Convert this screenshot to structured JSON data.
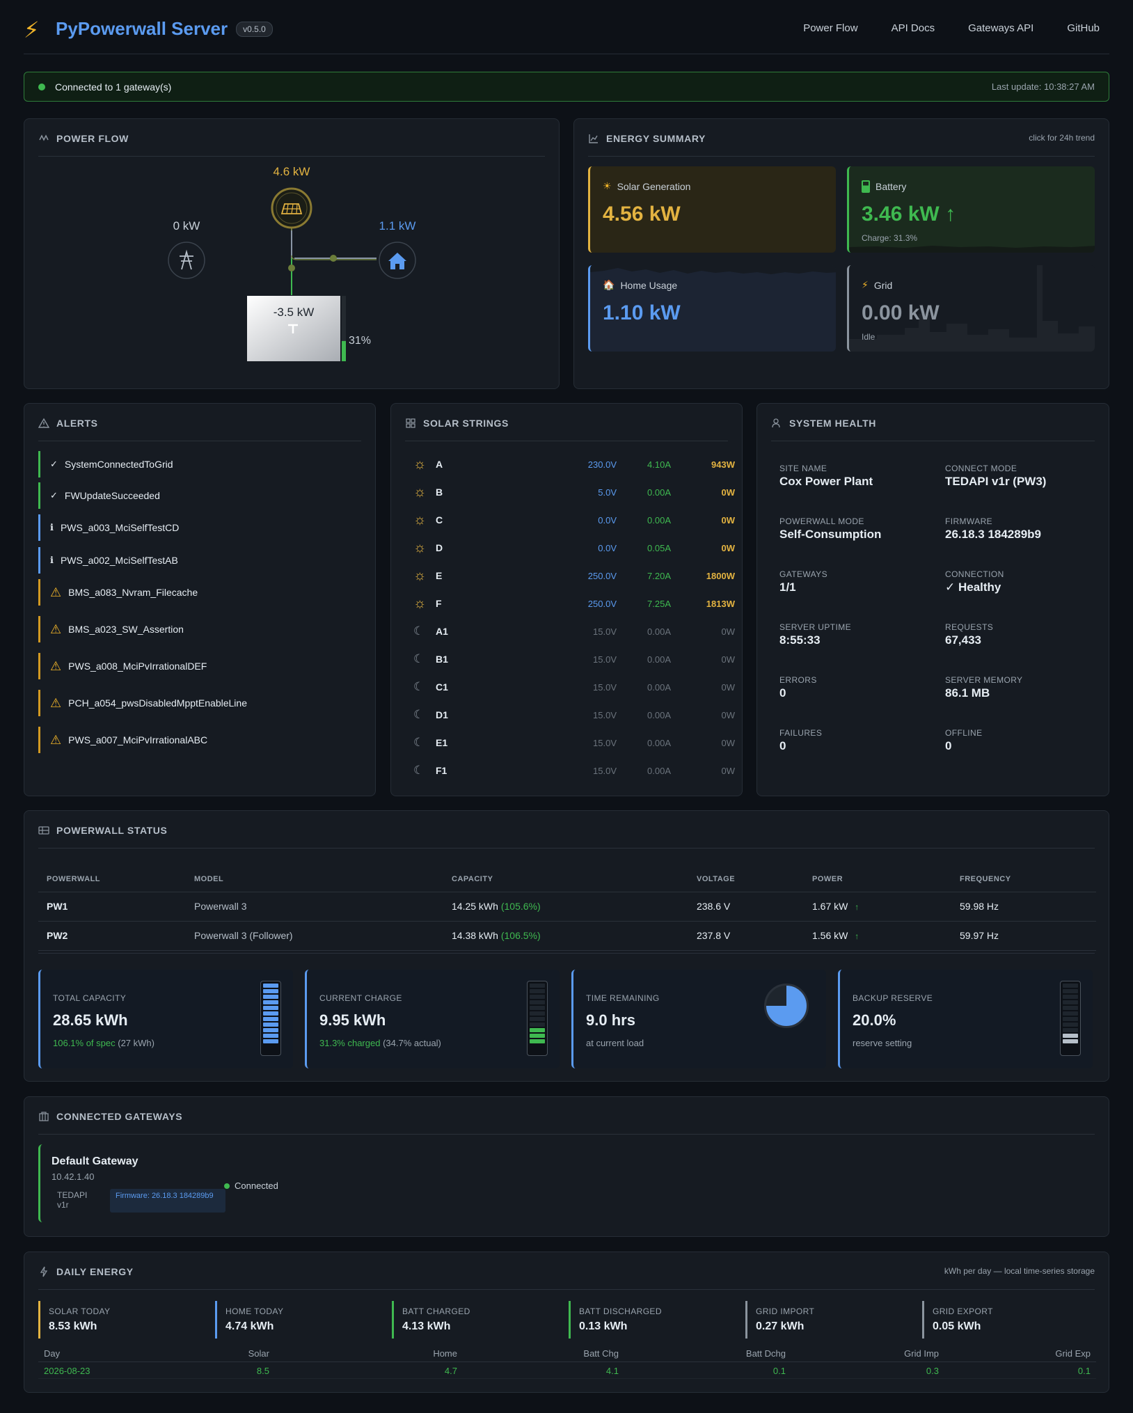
{
  "header": {
    "title": "PyPowerwall Server",
    "version": "v0.5.0",
    "nav": [
      "Power Flow",
      "API Docs",
      "Gateways API",
      "GitHub"
    ]
  },
  "banner": {
    "status": "Connected to 1 gateway(s)",
    "last_update": "Last update: 10:38:27 AM"
  },
  "power_flow": {
    "title": "POWER FLOW",
    "solar": "4.6 kW",
    "grid": "0 kW",
    "home": "1.1 kW",
    "battery": "-3.5 kW",
    "battery_pct": "31%",
    "battery_level": 0.31
  },
  "energy_summary": {
    "title": "ENERGY SUMMARY",
    "hint": "click for 24h trend",
    "solar": {
      "label": "Solar Generation",
      "value": "4.56 kW"
    },
    "battery": {
      "label": "Battery",
      "value": "3.46 kW",
      "arrow": "↑",
      "sub": "Charge: 31.3%"
    },
    "home": {
      "label": "Home Usage",
      "value": "1.10 kW"
    },
    "grid": {
      "label": "Grid",
      "value": "0.00 kW",
      "sub": "Idle"
    }
  },
  "alerts": {
    "title": "ALERTS",
    "items": [
      {
        "icon": "✓",
        "text": "SystemConnectedToGrid",
        "level": "ok"
      },
      {
        "icon": "✓",
        "text": "FWUpdateSucceeded",
        "level": "ok"
      },
      {
        "icon": "ℹ",
        "text": "PWS_a003_MciSelfTestCD",
        "level": "info"
      },
      {
        "icon": "ℹ",
        "text": "PWS_a002_MciSelfTestAB",
        "level": "info"
      },
      {
        "icon": "⚠",
        "text": "BMS_a083_Nvram_Filecache",
        "level": "warn"
      },
      {
        "icon": "⚠",
        "text": "BMS_a023_SW_Assertion",
        "level": "warn"
      },
      {
        "icon": "⚠",
        "text": "PWS_a008_MciPvIrrationalDEF",
        "level": "warn"
      },
      {
        "icon": "⚠",
        "text": "PCH_a054_pwsDisabledMpptEnableLine",
        "level": "warn"
      },
      {
        "icon": "⚠",
        "text": "PWS_a007_MciPvIrrationalABC",
        "level": "warn"
      }
    ]
  },
  "solar_strings": {
    "title": "SOLAR STRINGS",
    "rows": [
      {
        "name": "A",
        "v": "230.0V",
        "a": "4.10A",
        "w": "943W",
        "active": true
      },
      {
        "name": "B",
        "v": "5.0V",
        "a": "0.00A",
        "w": "0W",
        "active": true
      },
      {
        "name": "C",
        "v": "0.0V",
        "a": "0.00A",
        "w": "0W",
        "active": true
      },
      {
        "name": "D",
        "v": "0.0V",
        "a": "0.05A",
        "w": "0W",
        "active": true
      },
      {
        "name": "E",
        "v": "250.0V",
        "a": "7.20A",
        "w": "1800W",
        "active": true
      },
      {
        "name": "F",
        "v": "250.0V",
        "a": "7.25A",
        "w": "1813W",
        "active": true
      },
      {
        "name": "A1",
        "v": "15.0V",
        "a": "0.00A",
        "w": "0W",
        "active": false
      },
      {
        "name": "B1",
        "v": "15.0V",
        "a": "0.00A",
        "w": "0W",
        "active": false
      },
      {
        "name": "C1",
        "v": "15.0V",
        "a": "0.00A",
        "w": "0W",
        "active": false
      },
      {
        "name": "D1",
        "v": "15.0V",
        "a": "0.00A",
        "w": "0W",
        "active": false
      },
      {
        "name": "E1",
        "v": "15.0V",
        "a": "0.00A",
        "w": "0W",
        "active": false
      },
      {
        "name": "F1",
        "v": "15.0V",
        "a": "0.00A",
        "w": "0W",
        "active": false
      }
    ]
  },
  "system_health": {
    "title": "SYSTEM HEALTH",
    "items": [
      {
        "k": "SITE NAME",
        "v": "Cox Power Plant"
      },
      {
        "k": "CONNECT MODE",
        "v": "TEDAPI v1r (PW3)"
      },
      {
        "k": "POWERWALL MODE",
        "v": "Self-Consumption"
      },
      {
        "k": "FIRMWARE",
        "v": "26.18.3 184289b9"
      },
      {
        "k": "GATEWAYS",
        "v": "1/1"
      },
      {
        "k": "CONNECTION",
        "v": "✓ Healthy"
      },
      {
        "k": "SERVER UPTIME",
        "v": "8:55:33"
      },
      {
        "k": "REQUESTS",
        "v": "67,433"
      },
      {
        "k": "ERRORS",
        "v": "0"
      },
      {
        "k": "SERVER MEMORY",
        "v": "86.1 MB"
      },
      {
        "k": "FAILURES",
        "v": "0"
      },
      {
        "k": "OFFLINE",
        "v": "0"
      }
    ]
  },
  "powerwall_status": {
    "title": "POWERWALL STATUS",
    "columns": [
      "POWERWALL",
      "MODEL",
      "CAPACITY",
      "VOLTAGE",
      "POWER",
      "FREQUENCY"
    ],
    "rows": [
      {
        "pw": "PW1",
        "model": "Powerwall 3",
        "cap": "14.25 kWh",
        "pct": "(105.6%)",
        "volt": "238.6 V",
        "power": "1.67 kW",
        "arrow": "↑",
        "freq": "59.98 Hz"
      },
      {
        "pw": "PW2",
        "model": "Powerwall 3 (Follower)",
        "cap": "14.38 kWh",
        "pct": "(106.5%)",
        "volt": "237.8 V",
        "power": "1.56 kW",
        "arrow": "↑",
        "freq": "59.97 Hz"
      }
    ],
    "stats": [
      {
        "k": "TOTAL CAPACITY",
        "v": "28.65 kWh",
        "s1": "106.1% of spec",
        "s2": " (27 kWh)"
      },
      {
        "k": "CURRENT CHARGE",
        "v": "9.95 kWh",
        "s1": "31.3% charged",
        "s2": " (34.7% actual)"
      },
      {
        "k": "TIME REMAINING",
        "v": "9.0 hrs",
        "s1": "",
        "s2": "at current load"
      },
      {
        "k": "BACKUP RESERVE",
        "v": "20.0%",
        "s1": "",
        "s2": "reserve setting"
      }
    ],
    "total_capacity_level": 1.0,
    "charge_level": 0.313,
    "reserve_level": 0.2
  },
  "gateways": {
    "title": "CONNECTED GATEWAYS",
    "items": [
      {
        "name": "Default Gateway",
        "ip": "10.42.1.40",
        "type": "TEDAPI v1r",
        "firmware": "Firmware: 26.18.3 184289b9",
        "status": "Connected"
      }
    ]
  },
  "daily_energy": {
    "title": "DAILY ENERGY",
    "hint": "kWh per day — local time-series storage",
    "stats": [
      {
        "k": "SOLAR TODAY",
        "v": "8.53 kWh",
        "c": "#e3b341"
      },
      {
        "k": "HOME TODAY",
        "v": "4.74 kWh",
        "c": "#5b9bf0"
      },
      {
        "k": "BATT CHARGED",
        "v": "4.13 kWh",
        "c": "#3fb950"
      },
      {
        "k": "BATT DISCHARGED",
        "v": "0.13 kWh",
        "c": "#3fb950"
      },
      {
        "k": "GRID IMPORT",
        "v": "0.27 kWh",
        "c": "#8b949e"
      },
      {
        "k": "GRID EXPORT",
        "v": "0.05 kWh",
        "c": "#8b949e"
      }
    ],
    "columns": [
      "Day",
      "Solar",
      "Home",
      "Batt Chg",
      "Batt Dchg",
      "Grid Imp",
      "Grid Exp"
    ],
    "rows": [
      [
        "2026-08-23",
        "8.5",
        "4.7",
        "4.1",
        "0.1",
        "0.3",
        "0.1"
      ]
    ]
  },
  "colors": {
    "solar": "#e3b341",
    "battery": "#3fb950",
    "home": "#5b9bf0",
    "grid": "#8b949e",
    "warn": "#f0b429"
  }
}
